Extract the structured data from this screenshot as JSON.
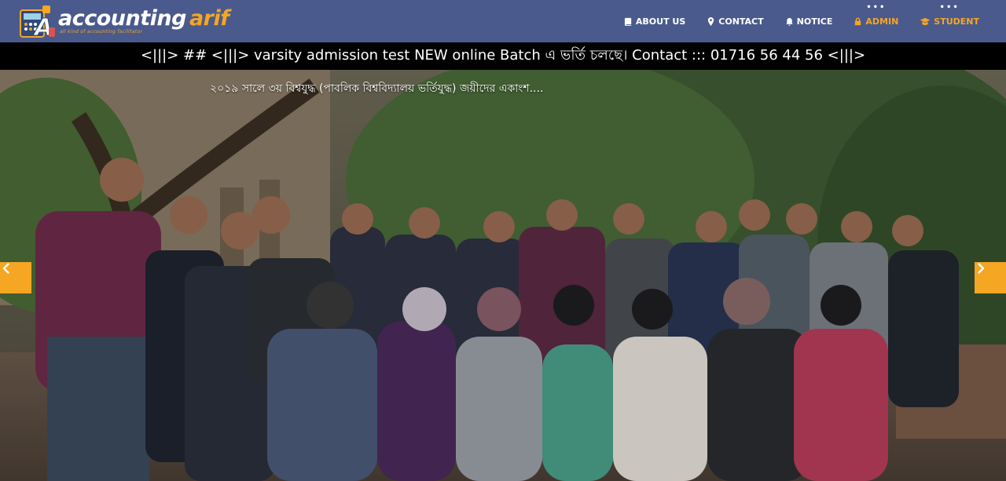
{
  "brand": {
    "word1": "accounting",
    "word2": "arif",
    "tagline": "all kind of accounting facilitator"
  },
  "nav": {
    "items": [
      {
        "label": "ABOUT US",
        "icon": "book-icon",
        "accent": false
      },
      {
        "label": "CONTACT",
        "icon": "map-marker-icon",
        "accent": false
      },
      {
        "label": "NOTICE",
        "icon": "bell-icon",
        "accent": false
      },
      {
        "label": "ADMIN",
        "icon": "lock-icon",
        "accent": true
      },
      {
        "label": "STUDENT",
        "icon": "graduation-cap-icon",
        "accent": true
      }
    ]
  },
  "ticker": {
    "text": "<|||> ## <|||> varsity admission test NEW online Batch এ ভর্তি চলছে। Contact ::: 01716 56 44 56 <|||>"
  },
  "hero": {
    "caption": "২০১৯ সালে ৩য় বিশ্বযুদ্ধ (পাবলিক বিশ্ববিদ্যালয় ভর্তিযুদ্ধ) জয়ীদের একাংশ....",
    "prev_icon": "chevron-left-icon",
    "next_icon": "chevron-right-icon"
  },
  "colors": {
    "navbar": "#4a5a8c",
    "accent": "#f5a623",
    "ticker_bg": "#000000"
  }
}
